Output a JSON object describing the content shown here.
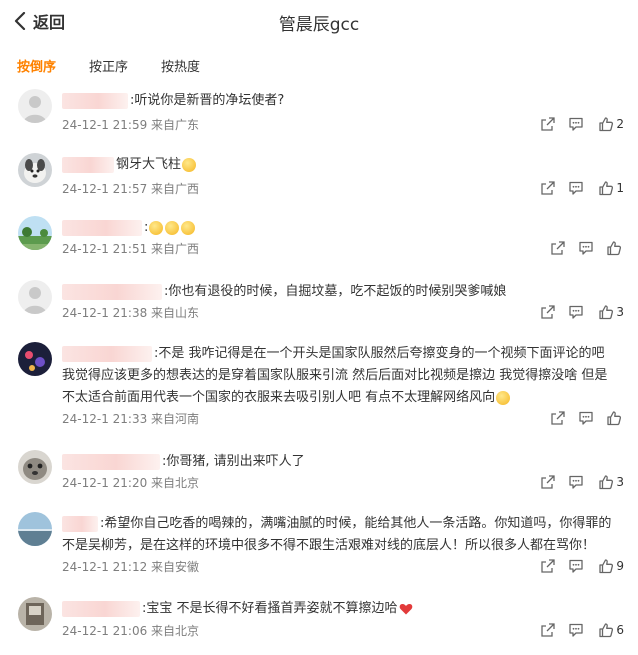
{
  "header": {
    "back_label": "返回",
    "title": "管晨辰gcc"
  },
  "tabs": [
    {
      "label": "按倒序",
      "active": true
    },
    {
      "label": "按正序",
      "active": false
    },
    {
      "label": "按热度",
      "active": false
    }
  ],
  "comments": [
    {
      "text": ":听说你是新晋的净坛使者?",
      "time": "24-12-1 21:59 来自广东",
      "likes": "2"
    },
    {
      "text": "钢牙大飞柱",
      "time": "24-12-1 21:57 来自广西",
      "likes": "1"
    },
    {
      "text": ":",
      "time": "24-12-1 21:51 来自广西",
      "likes": ""
    },
    {
      "text": ":你也有退役的时候，自掘坟墓，吃不起饭的时候别哭爹喊娘",
      "time": "24-12-1 21:38 来自山东",
      "likes": "3"
    },
    {
      "text": ":不是 我咋记得是在一个开头是国家队服然后夸擦变身的一个视频下面评论的吧 我觉得应该更多的想表达的是穿着国家队服来引流 然后后面对比视频是擦边 我觉得擦没啥 但是不太适合前面用代表一个国家的衣服来去吸引别人吧 有点不太理解网络风向",
      "time": "24-12-1 21:33 来自河南",
      "likes": ""
    },
    {
      "text": ":你哥猪, 请别出来吓人了",
      "time": "24-12-1 21:20 来自北京",
      "likes": "3"
    },
    {
      "text": ":希望你自己吃香的喝辣的，满嘴油腻的时候，能给其他人一条活路。你知道吗，你得罪的不是吴柳芳，是在这样的环境中很多不得不跟生活艰难对线的底层人！所以很多人都在骂你！",
      "time": "24-12-1 21:12 来自安徽",
      "likes": "9"
    },
    {
      "text": ":宝宝 不是长得不好看搔首弄姿就不算擦边哈",
      "time": "24-12-1 21:06 来自北京",
      "likes": "6"
    }
  ],
  "colors": {
    "accent": "#ff8200",
    "meta": "#7e7e7e",
    "text": "#333333"
  }
}
